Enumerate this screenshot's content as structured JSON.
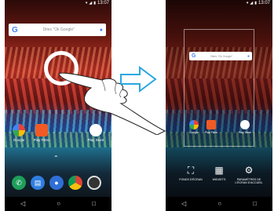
{
  "status": {
    "time": "13:07"
  },
  "search": {
    "placeholder": "Dites \"Ok Google\"",
    "logo": "G"
  },
  "apps": [
    {
      "label": "Google",
      "color": "#e8e8e8"
    },
    {
      "label": "Play Films",
      "color": "#f15a24"
    },
    {
      "label": "Play Store",
      "color": "#ffffff"
    }
  ],
  "dock": [
    {
      "icon": "phone-icon",
      "color": "#1e9e5a"
    },
    {
      "icon": "messages-icon",
      "color": "#2f7de1"
    },
    {
      "icon": "contacts-icon",
      "color": "#2f6fd6"
    },
    {
      "icon": "chrome-icon",
      "color": "#db4437"
    },
    {
      "icon": "camera-icon",
      "color": "#333333"
    }
  ],
  "options": [
    {
      "label": "FONDS D'ÉCRAN",
      "icon": "wallpaper-icon"
    },
    {
      "label": "WIDGETS",
      "icon": "widgets-icon"
    },
    {
      "label": "PARAMÈTRES DE L'ÉCRAN D'ACCUEIL",
      "icon": "settings-icon"
    }
  ],
  "colors": {
    "accent": "#4285f4",
    "arrow": "#2aa7e0"
  }
}
